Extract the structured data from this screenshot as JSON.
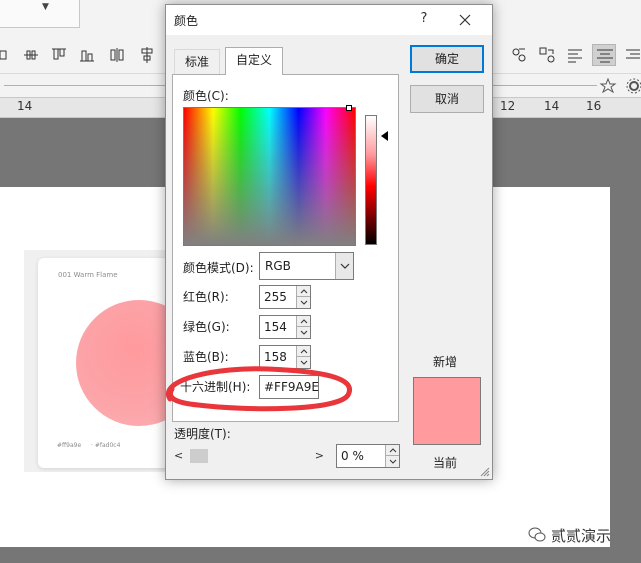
{
  "background": {
    "ruler_numbers": [
      "14",
      "12",
      "14",
      "16"
    ],
    "card_title": "001 Warm Flame",
    "swatch_labels": [
      "#ff9a9e",
      "#fad0c4"
    ],
    "watermark": "贰贰演示",
    "brand_color": "#ff9a9e"
  },
  "dialog": {
    "title": "颜色",
    "help_label": "?",
    "tabs": [
      {
        "label": "标准",
        "active": false
      },
      {
        "label": "自定义",
        "active": true
      }
    ],
    "color_label": "颜色(C):",
    "color_label_key": "C",
    "color_mode": {
      "label": "颜色模式(D):",
      "value": "RGB"
    },
    "red": {
      "label": "红色(R):",
      "value": "255"
    },
    "green": {
      "label": "绿色(G):",
      "value": "154"
    },
    "blue": {
      "label": "蓝色(B):",
      "value": "158"
    },
    "hex": {
      "label": "十六进制(H):",
      "value": "#FF9A9E"
    },
    "transparency": {
      "label": "透明度(T):",
      "value": "0 %"
    },
    "ok_label": "确定",
    "cancel_label": "取消",
    "new_label": "新增",
    "current_label": "当前",
    "new_color": "#ff9a9e",
    "current_color": "#ff9a9e"
  }
}
